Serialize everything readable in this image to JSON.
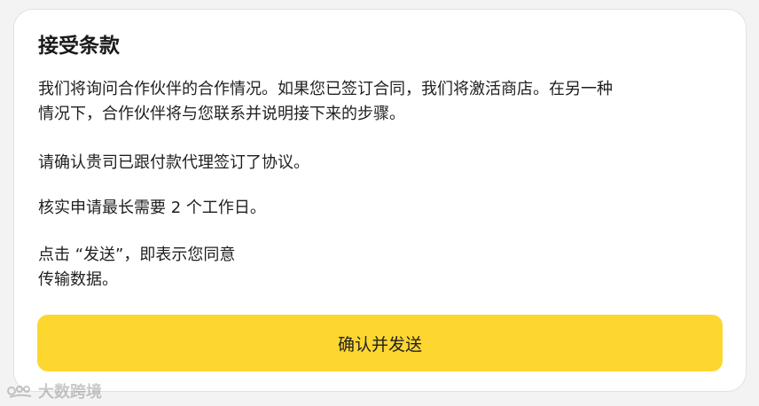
{
  "dialog": {
    "title": "接受条款",
    "paragraph1": {
      "line1": "我们将询问合作伙伴的合作情况。如果您已签订合同，我们将激活商店。在另一种",
      "line2": "情况下，合作伙伴将与您联系并说明接下来的步骤。"
    },
    "paragraph2": "请确认贵司已跟付款代理签订了协议。",
    "paragraph3": "核实申请最长需要 2 个工作日。",
    "paragraph4": {
      "line1": "点击 “发送”，即表示您同意",
      "line2": "传输数据。"
    },
    "confirm_button_label": "确认并发送"
  },
  "watermark": {
    "text": "大数跨境"
  },
  "colors": {
    "accent": "#fdd630",
    "text": "#1f1f1f",
    "card_background": "#ffffff"
  }
}
